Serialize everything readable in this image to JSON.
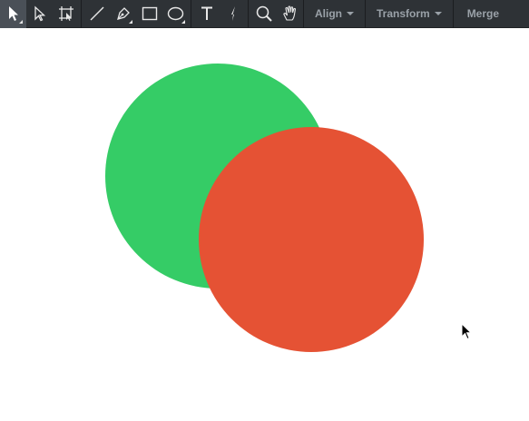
{
  "toolbar": {
    "tools": [
      {
        "icon": "selection-arrow-icon",
        "active": true
      },
      {
        "icon": "direct-selection-icon",
        "active": false
      },
      {
        "icon": "artboard-icon",
        "active": false
      },
      {
        "icon": "line-icon",
        "active": false
      },
      {
        "icon": "pen-icon",
        "active": false
      },
      {
        "icon": "rectangle-icon",
        "active": false
      },
      {
        "icon": "ellipse-icon",
        "active": false
      },
      {
        "icon": "text-icon",
        "active": false
      },
      {
        "icon": "knife-icon",
        "active": false
      },
      {
        "icon": "zoom-icon",
        "active": false
      },
      {
        "icon": "hand-icon",
        "active": false
      }
    ],
    "align_label": "Align",
    "transform_label": "Transform",
    "merge_label": "Merge"
  },
  "canvas": {
    "background": "#ffffff",
    "shapes": [
      {
        "name": "green-circle",
        "color": "#35cc66"
      },
      {
        "name": "red-circle",
        "color": "#e55234"
      }
    ]
  },
  "colors": {
    "toolbar_bg": "#2e3236",
    "active_tool_bg": "#4a5057",
    "menu_text": "#9aa1a8"
  }
}
